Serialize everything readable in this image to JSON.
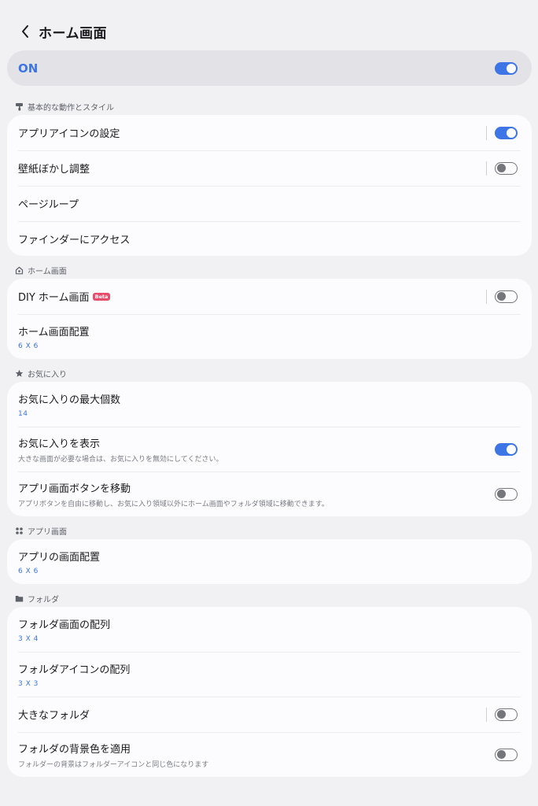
{
  "header": {
    "title": "ホーム画面"
  },
  "master": {
    "label": "ON",
    "state": "on"
  },
  "sections": {
    "basic": {
      "title": "基本的な動作とスタイル",
      "icon": "paint-roller-icon",
      "items": [
        {
          "title": "アプリアイコンの設定",
          "toggle": "on"
        },
        {
          "title": "壁紙ぼかし調整",
          "toggle": "off"
        },
        {
          "title": "ページループ"
        },
        {
          "title": "ファインダーにアクセス"
        }
      ]
    },
    "home": {
      "title": "ホーム画面",
      "icon": "home-icon",
      "items": [
        {
          "title": "DIY ホーム画面",
          "badge": "Beta",
          "toggle": "off"
        },
        {
          "title": "ホーム画面配置",
          "value": "6 X 6"
        }
      ]
    },
    "favorites": {
      "title": "お気に入り",
      "icon": "star-icon",
      "items": [
        {
          "title": "お気に入りの最大個数",
          "value": "14"
        },
        {
          "title": "お気に入りを表示",
          "subtitle": "大きな画面が必要な場合は、お気に入りを無効にしてください。",
          "toggle": "on"
        },
        {
          "title": "アプリ画面ボタンを移動",
          "subtitle": "アプリボタンを自由に移動し、お気に入り領域以外にホーム画面やフォルダ領域に移動できます。",
          "toggle": "off"
        }
      ]
    },
    "apps": {
      "title": "アプリ画面",
      "icon": "apps-grid-icon",
      "items": [
        {
          "title": "アプリの画面配置",
          "value": "6 X 6"
        }
      ]
    },
    "folders": {
      "title": "フォルダ",
      "icon": "folder-icon",
      "items": [
        {
          "title": "フォルダ画面の配列",
          "value": "3 X 4"
        },
        {
          "title": "フォルダアイコンの配列",
          "value": "3 X 3"
        },
        {
          "title": "大きなフォルダ",
          "toggle": "off"
        },
        {
          "title": "フォルダの背景色を適用",
          "subtitle": "フォルダーの背景はフォルダーアイコンと同じ色になります",
          "toggle": "off"
        }
      ]
    }
  },
  "colors": {
    "accent": "#3d75e6",
    "background": "#f1f1f4",
    "card": "#fcfcff",
    "beta": "#e54d6b"
  }
}
